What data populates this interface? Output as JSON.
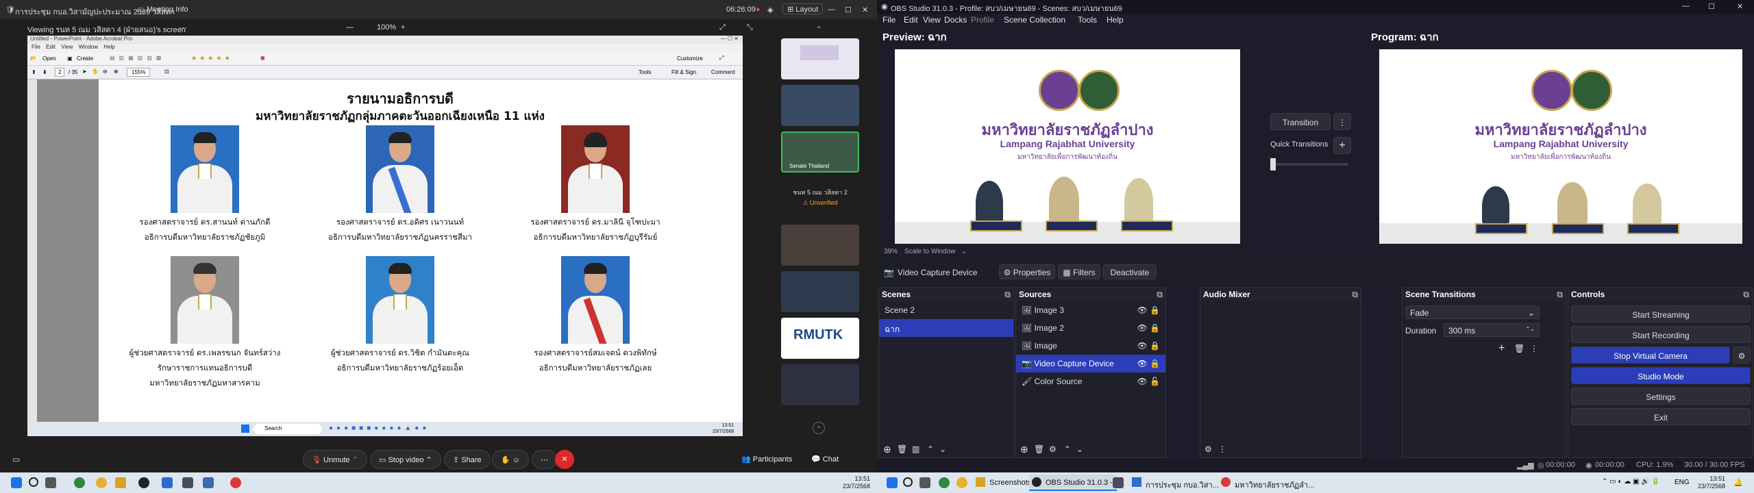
{
  "zoom": {
    "title_left": "การประชุม กบอ.วิสามัญปะประมาณ 2569 วสิสตา",
    "meeting_info": "Meeting Info",
    "timer": "06:26:09",
    "layout_label": "Layout",
    "viewing_label": "Viewing รนท 5 ณม วสิสตา 4 (ฝ่ายสนอ)'s screen",
    "zoom_level": "100%",
    "toolbar": {
      "unmute": "Unmute",
      "stop_video": "Stop video",
      "share": "Share",
      "participants": "Participants",
      "chat": "Chat"
    },
    "unverified_name": "ชนท 5 ณม วสิสตา 2",
    "unverified_label": "Unverified",
    "senate_label": "Senate Thailand",
    "strip_logo_text": "RMUTK"
  },
  "acrobat": {
    "window_title": "Untitled - PowerPoint - Adobe Acrobat Pro",
    "menu": [
      "File",
      "Edit",
      "View",
      "Window",
      "Help"
    ],
    "open_label": "Open",
    "create_label": "Create",
    "customize_label": "Customize",
    "page_current": "2",
    "page_total": "/ 35",
    "zoom": "155%",
    "tools": "Tools",
    "fill_sign": "Fill & Sign",
    "comment": "Comment"
  },
  "document": {
    "title": "รายนามอธิการบดี",
    "subtitle": "มหาวิทยาลัยราชภัฏกลุ่มภาคตะวันออกเฉียงเหนือ 11 แห่ง",
    "people": [
      {
        "name": "รองศาสตราจารย์ ดร.สานนท์  ด่านภักดี",
        "position": "อธิการบดีมหาวิทยาลัยราชภัฏชัยภูมิ",
        "position2": ""
      },
      {
        "name": "รองศาสตราจารย์ ดร.อดิศร  เนาวนนท์",
        "position": "อธิการบดีมหาวิทยาลัยราชภัฏนครราชสีมา",
        "position2": ""
      },
      {
        "name": "รองศาสตราจารย์ ดร.มาลินี  จุโฑปะมา",
        "position": "อธิการบดีมหาวิทยาลัยราชภัฏบุรีรัมย์",
        "position2": ""
      },
      {
        "name": "ผู้ช่วยศาสตราจารย์ ดร.เพลรขนก จันทร์สว่าง",
        "position": "รักษาราชการแทนอธิการบดี",
        "position2": "มหาวิทยาลัยราชภัฏมหาสารคาม"
      },
      {
        "name": "ผู้ช่วยศาสตราจารย์ ดร.วิชิต กำมันตะคุณ",
        "position": "อธิการบดีมหาวิทยาลัยราชภัฏร้อยเอ็ด",
        "position2": ""
      },
      {
        "name": "รองศาสตราจารย์สมเจตน์  ดวงพิทักษ์",
        "position": "อธิการบดีมหาวิทยาลัยราชภัฏเลย",
        "position2": ""
      }
    ]
  },
  "inner_taskbar": {
    "search": "Search",
    "time": "13:51",
    "date": "23/7/2568"
  },
  "obs": {
    "title": "OBS Studio 31.0.3 - Profile: สบว/เมษายน69 - Scenes: สบว/เมษายน69",
    "menu": [
      "File",
      "Edit",
      "View",
      "Docks",
      "Profile",
      "Scene Collection",
      "Tools",
      "Help"
    ],
    "preview_label": "Preview: ฉาก",
    "program_label": "Program: ฉาก",
    "screen": {
      "thai_name": "มหาวิทยาลัยราชภัฏลำปาง",
      "en_name": "Lampang Rajabhat University",
      "slogan": "มหาวิทยาลัยเพื่อการพัฒนาท้องถิ่น"
    },
    "preview_zoom": "39%",
    "scale_label": "Scale to Window",
    "transition_button": "Transition",
    "quick_transitions": "Quick Transitions",
    "source_bar": {
      "name": "Video Capture Device",
      "properties": "Properties",
      "filters": "Filters",
      "deactivate": "Deactivate"
    },
    "scenes": {
      "title": "Scenes",
      "items": [
        "Scene 2",
        "ฉาก"
      ]
    },
    "sources": {
      "title": "Sources",
      "items": [
        "Image 3",
        "Image 2",
        "Image",
        "Video Capture Device",
        "Color Source"
      ]
    },
    "audio_mixer": {
      "title": "Audio Mixer"
    },
    "scene_transitions": {
      "title": "Scene Transitions",
      "type": "Fade",
      "duration_label": "Duration",
      "duration_value": "300 ms"
    },
    "controls": {
      "title": "Controls",
      "start_streaming": "Start Streaming",
      "start_recording": "Start Recording",
      "stop_virtual_camera": "Stop Virtual Camera",
      "studio_mode": "Studio Mode",
      "settings": "Settings",
      "exit": "Exit"
    },
    "status": {
      "stream_time": "00:00:00",
      "rec_time": "00:00:00",
      "cpu": "CPU: 1.9%",
      "fps": "30.00 / 30.00 FPS"
    }
  },
  "taskbar": {
    "apps": [
      "Screenshots",
      "OBS Studio 31.0.3 -",
      "การประชุม กบอ.วิสา...",
      "มหาวิทยาลัยราชภัฏลำ..."
    ],
    "lang": "ENG",
    "time": "13:51",
    "date": "23/7/2568",
    "left_time": "13:51",
    "left_date": "23/7/2568"
  },
  "colors": {
    "obs_accent": "#2b3eb8",
    "zoom_red": "#e02828",
    "purple": "#6b3f92"
  }
}
